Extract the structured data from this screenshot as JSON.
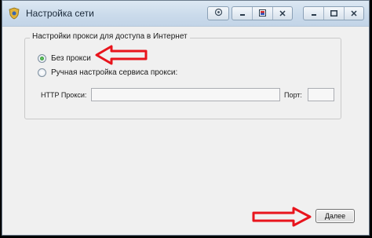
{
  "window": {
    "title": "Настройка сети"
  },
  "proxy_group": {
    "legend": "Настройки прокси для доступа в Интернет",
    "options": [
      {
        "label": "Без прокси",
        "selected": true
      },
      {
        "label": "Ручная настройка сервиса прокси:",
        "selected": false
      }
    ],
    "http_proxy_label": "HTTP Прокси:",
    "http_proxy_value": "",
    "port_label": "Порт:",
    "port_value": ""
  },
  "footer": {
    "next_label": "Далее"
  },
  "colors": {
    "annotation_arrow": "#e8141c"
  }
}
